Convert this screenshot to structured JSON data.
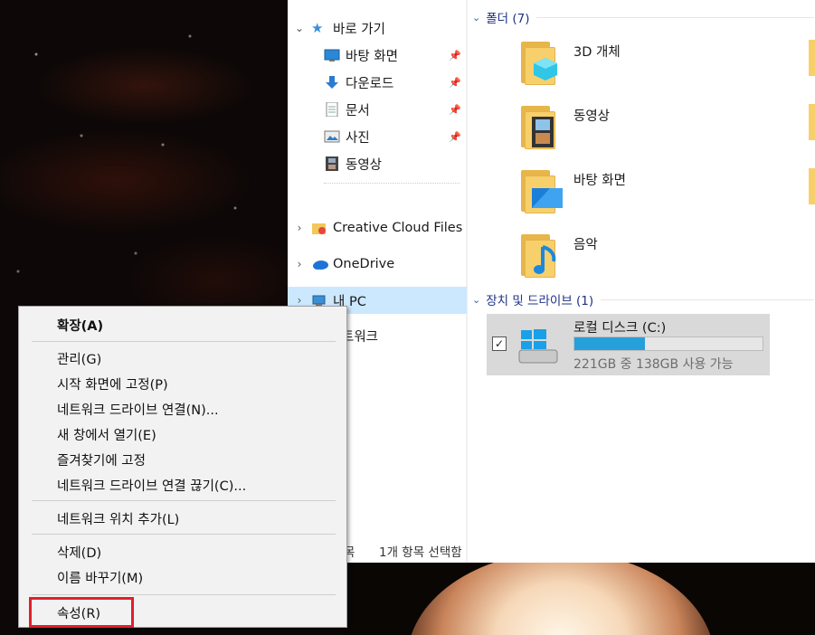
{
  "nav": {
    "quick_access": "바로 가기",
    "items": [
      {
        "label": "바탕 화면",
        "pinned": true,
        "icon": "desktop-icon"
      },
      {
        "label": "다운로드",
        "pinned": true,
        "icon": "download-arrow-icon"
      },
      {
        "label": "문서",
        "pinned": true,
        "icon": "document-icon"
      },
      {
        "label": "사진",
        "pinned": true,
        "icon": "pictures-icon"
      },
      {
        "label": "동영상",
        "pinned": false,
        "icon": "videos-icon"
      }
    ],
    "creative_cloud": "Creative Cloud Files",
    "onedrive": "OneDrive",
    "this_pc": "내 PC",
    "network": "트워크"
  },
  "content": {
    "folders_group": "폴더 (7)",
    "folders": [
      "3D 개체",
      "동영상",
      "바탕 화면",
      "음악"
    ],
    "drives_group": "장치 및 드라이브 (1)",
    "drive": {
      "name": "로컬 디스크 (C:)",
      "space": "221GB 중 138GB 사용 가능",
      "used_fraction": 0.376
    }
  },
  "status": {
    "items": "목",
    "selected": "1개 항목 선택함"
  },
  "menu": {
    "expand": "확장(A)",
    "manage": "관리(G)",
    "pin_start": "시작 화면에 고정(P)",
    "map_drive": "네트워크 드라이브 연결(N)...",
    "open_new": "새 창에서 열기(E)",
    "pin_quick": "즐겨찾기에 고정",
    "disconnect": "네트워크 드라이브 연결 끊기(C)...",
    "add_network": "네트워크 위치 추가(L)",
    "delete": "삭제(D)",
    "rename": "이름 바꾸기(M)",
    "properties": "속성(R)"
  },
  "colors": {
    "selection": "#cce8ff",
    "drive_bar": "#26a0da",
    "highlight_box": "#e0202a",
    "group_header": "#1e3287"
  }
}
